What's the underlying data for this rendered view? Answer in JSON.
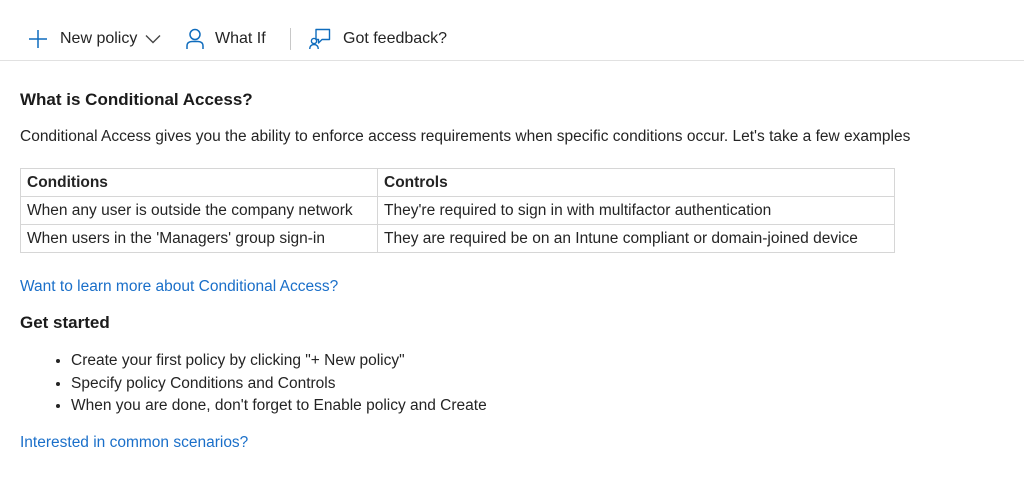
{
  "toolbar": {
    "new_policy_label": "New policy",
    "what_if_label": "What If",
    "feedback_label": "Got feedback?"
  },
  "main": {
    "title": "What is Conditional Access?",
    "intro": "Conditional Access gives you the ability to enforce access requirements when specific conditions occur. Let's take a few examples",
    "table": {
      "headers": [
        "Conditions",
        "Controls"
      ],
      "rows": [
        [
          "When any user is outside the company network",
          "They're required to sign in with multifactor authentication"
        ],
        [
          "When users in the 'Managers' group sign-in",
          "They are required be on an Intune compliant or domain-joined device"
        ]
      ]
    },
    "learn_more_link": "Want to learn more about Conditional Access?",
    "get_started_title": "Get started",
    "steps": [
      "Create your first policy by clicking \"+ New policy\"",
      "Specify policy Conditions and Controls",
      "When you are done, don't forget to Enable policy and Create"
    ],
    "scenarios_link": "Interested in common scenarios?"
  },
  "colors": {
    "link": "#1a6fc9",
    "icon_blue": "#0f6cbd",
    "border": "#d6d6d6"
  }
}
